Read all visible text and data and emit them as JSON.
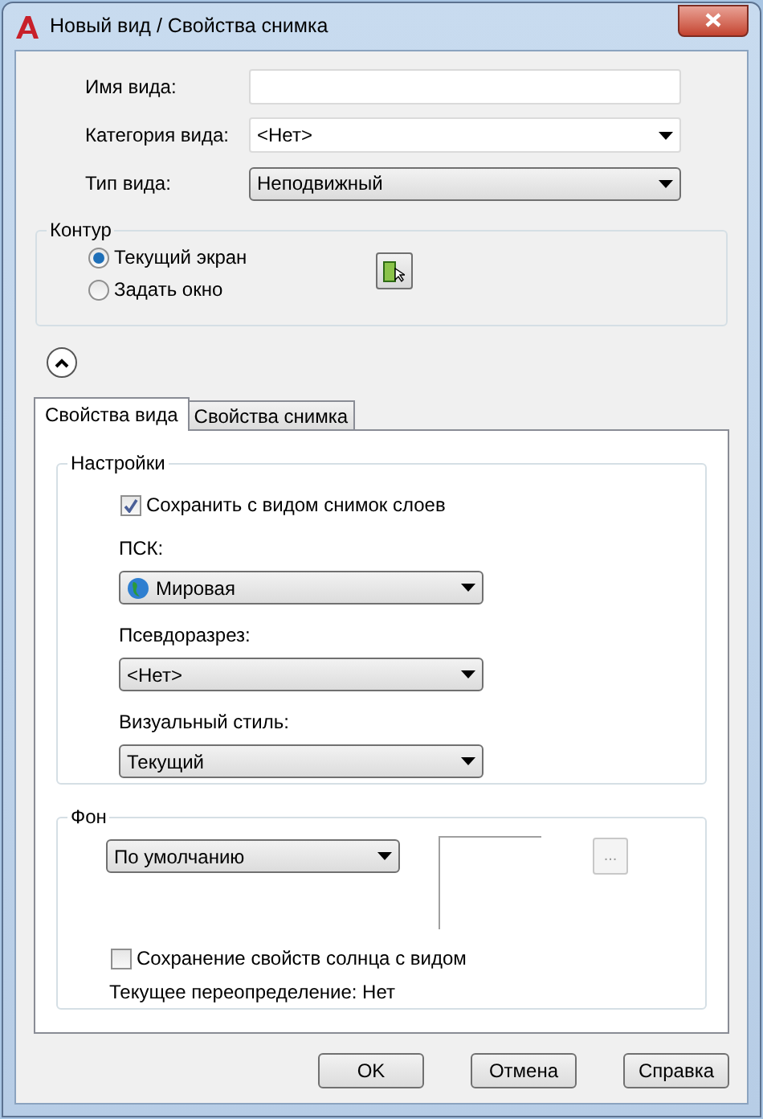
{
  "window": {
    "title": "Новый вид / Свойства снимка"
  },
  "fields": [
    {
      "label": "Имя вида:",
      "kind": "input"
    },
    {
      "label": "Категория вида:",
      "kind": "combo",
      "value": "<Нет>"
    },
    {
      "label": "Тип вида:",
      "kind": "dropdown",
      "value": "Неподвижный"
    }
  ],
  "contour": {
    "title": "Контур",
    "options": [
      {
        "label": "Текущий экран",
        "selected": true
      },
      {
        "label": "Задать окно",
        "selected": false
      }
    ]
  },
  "details_expanded": true,
  "tabs": [
    {
      "label": "Свойства вида",
      "selected": true
    },
    {
      "label": "Свойства снимка",
      "selected": false
    }
  ],
  "settings": {
    "title": "Настройки",
    "save_layers": {
      "label": "Сохранить с видом снимок слоев",
      "checked": true
    },
    "dropdowns": [
      {
        "label": "ПСК:",
        "value": "Мировая",
        "kind": "globe"
      },
      {
        "label": "Псевдоразрез:",
        "value": "<Нет>",
        "kind": "plain"
      },
      {
        "label": "Визуальный стиль:",
        "value": "Текущий",
        "kind": "plain"
      }
    ]
  },
  "background": {
    "title": "Фон",
    "value": "По умолчанию",
    "more_button": "...",
    "sun": {
      "label": "Сохранение свойств солнца с видом",
      "checked": false
    },
    "override": "Текущее переопределение: Нет"
  },
  "buttons": [
    {
      "label": "OK"
    },
    {
      "label": "Отмена"
    },
    {
      "label": "Справка"
    }
  ]
}
